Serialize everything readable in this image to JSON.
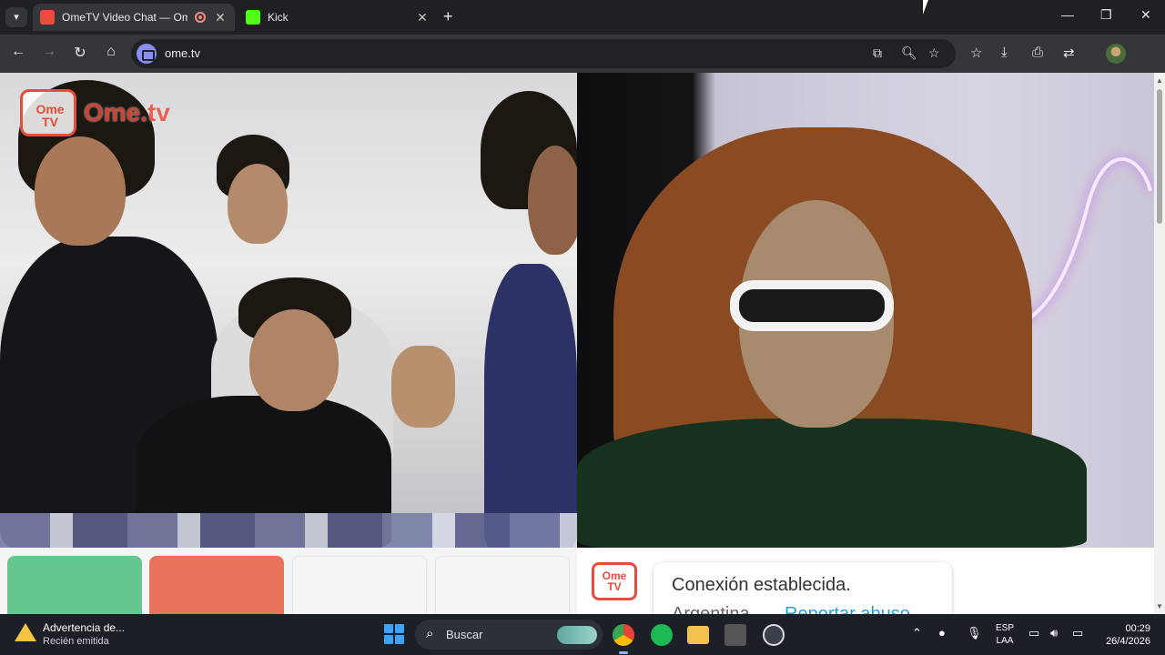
{
  "browser": {
    "tabs": [
      {
        "title": "OmeTV Video Chat — Ome",
        "favicon_color": "#e74c3c",
        "recording": true,
        "active": true
      },
      {
        "title": "Kick",
        "favicon_color": "#53fc18",
        "active": false
      }
    ],
    "new_tab_icon": "plus-icon",
    "window_controls": {
      "minimize": "—",
      "restore": "❐",
      "close": "✕"
    },
    "toolbar": {
      "back": "←",
      "forward": "→",
      "reload": "↻",
      "home": "⌂",
      "url": "ome.tv"
    }
  },
  "page": {
    "logo_tv_text": "Ome TV",
    "logo_text": "Ome.tv",
    "tile_colors": [
      "#66c78e",
      "#e8735a",
      "#f5f5f5",
      "#f5f5f5"
    ],
    "chat": {
      "logo_text": "Ome TV",
      "status": "Conexión establecida.",
      "country": "Argentina",
      "report_link": "Reportar abuso"
    }
  },
  "taskbar": {
    "notification_title": "Advertencia de...",
    "notification_subtitle": "Recién emitida",
    "search_placeholder": "Buscar",
    "language_line1": "ESP",
    "language_line2": "LAA",
    "time": "00:29",
    "date": "26/4/2026"
  },
  "colors": {
    "accent_red": "#e74c3c",
    "link_blue": "#2a9fd6",
    "browser_dark": "#35363a",
    "taskbar": "#1c1f26"
  }
}
